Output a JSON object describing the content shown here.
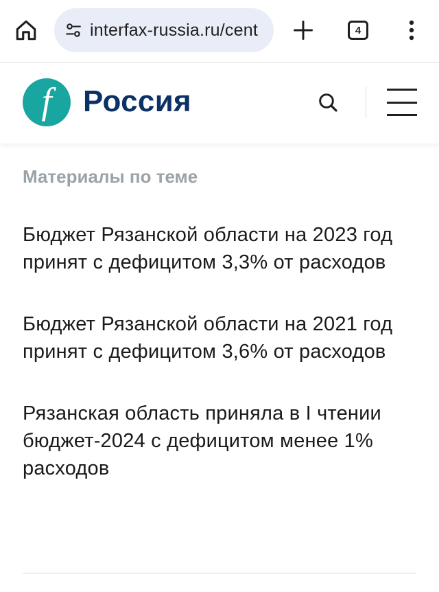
{
  "browser": {
    "url": "interfax-russia.ru/cent",
    "tab_count": "4",
    "icons": {
      "home": "home-icon",
      "site_settings": "site-settings-icon",
      "new_tab": "plus-icon",
      "more": "more-vertical-icon"
    }
  },
  "header": {
    "logo_letter": "f",
    "title": "Россия",
    "colors": {
      "logo_bg": "#1aa6a0",
      "title": "#0b3165"
    }
  },
  "related": {
    "title": "Материалы по теме",
    "items": [
      {
        "text": "Бюджет Рязанской области на 2023 год принят с дефицитом 3,3% от расходов"
      },
      {
        "text": "Бюджет Рязанской области на 2021 год принят с дефицитом 3,6% от расходов"
      },
      {
        "text": "Рязанская область приняла в I чтении бюджет-2024 с дефицитом менее 1% расходов"
      }
    ]
  }
}
